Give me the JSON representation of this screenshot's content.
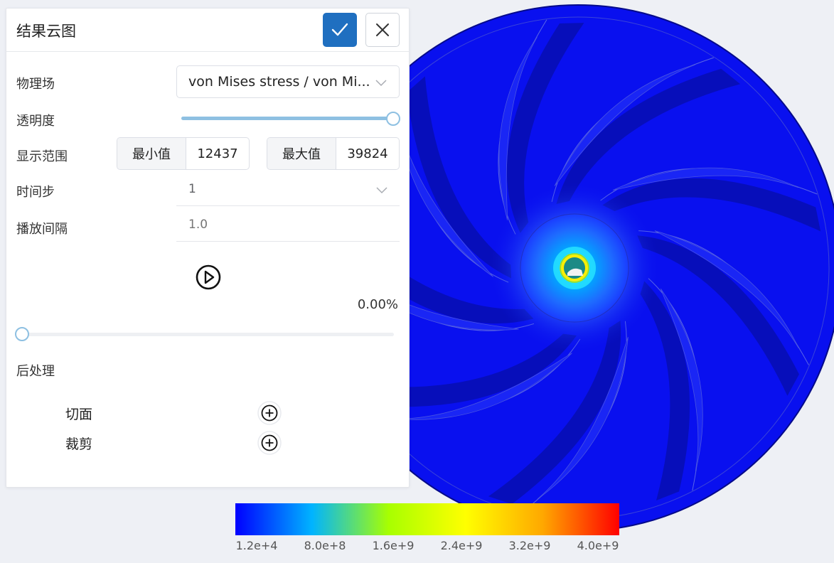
{
  "panel": {
    "title": "结果云图",
    "confirm_icon": "check-icon",
    "close_icon": "close-icon",
    "field": {
      "label": "物理场",
      "value": "von Mises stress / von Mi..."
    },
    "opacity": {
      "label": "透明度",
      "value": 1.0
    },
    "display_range": {
      "label": "显示范围",
      "min_label": "最小值",
      "min_value": "12437",
      "max_label": "最大值",
      "max_value": "39824"
    },
    "timestep": {
      "label": "时间步",
      "value": "1"
    },
    "interval": {
      "label": "播放间隔",
      "placeholder": "1.0"
    },
    "playback": {
      "icon": "play-icon",
      "progress_text": "0.00%",
      "progress": 0.0
    },
    "postprocess": {
      "label": "后处理",
      "items": [
        {
          "label": "切面",
          "icon": "add-circle-icon"
        },
        {
          "label": "裁剪",
          "icon": "add-circle-icon"
        }
      ]
    }
  },
  "colorbar": {
    "ticks": [
      "1.2e+4",
      "8.0e+8",
      "1.6e+9",
      "2.4e+9",
      "3.2e+9",
      "4.0e+9"
    ],
    "colors": [
      "#0000ff",
      "#00b4ff",
      "#a8ff00",
      "#ffff00",
      "#ffa800",
      "#ff0000"
    ]
  },
  "colors": {
    "accent": "#1f6fc0",
    "slider": "#8ec0e2",
    "impeller_base": "#0a14f0",
    "background": "#eef0f5"
  }
}
